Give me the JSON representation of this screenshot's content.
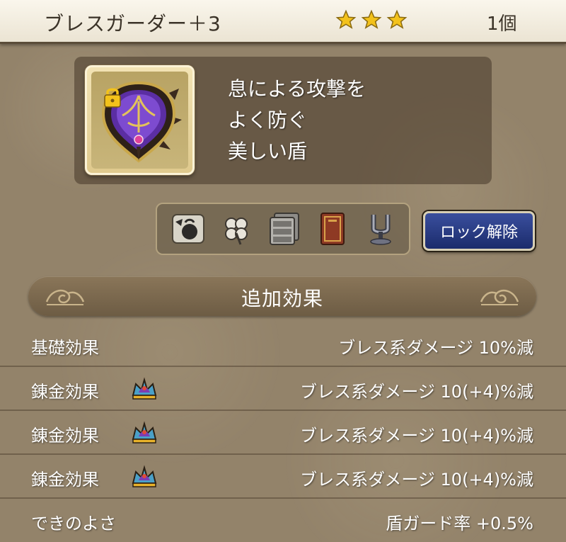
{
  "header": {
    "item_name": "ブレスガーダー＋3",
    "stars": 3,
    "count": "1個"
  },
  "item": {
    "icon": "purple-shield-icon",
    "locked": true,
    "description_lines": [
      "息による攻撃を",
      "よく防ぐ",
      "美しい盾"
    ]
  },
  "tools": [
    {
      "icon": "bag-icon"
    },
    {
      "icon": "clover-icon"
    },
    {
      "icon": "drawer-icon"
    },
    {
      "icon": "book-icon"
    },
    {
      "icon": "tuning-fork-icon"
    }
  ],
  "unlock_button": {
    "label": "ロック解除"
  },
  "section": {
    "title": "追加効果"
  },
  "effects": [
    {
      "label": "基礎効果",
      "alchemy_icon": false,
      "value": "ブレス系ダメージ  10%減"
    },
    {
      "label": "錬金効果",
      "alchemy_icon": true,
      "value": "ブレス系ダメージ  10(+4)%減"
    },
    {
      "label": "錬金効果",
      "alchemy_icon": true,
      "value": "ブレス系ダメージ  10(+4)%減"
    },
    {
      "label": "錬金効果",
      "alchemy_icon": true,
      "value": "ブレス系ダメージ  10(+4)%減"
    },
    {
      "label": "できのよさ",
      "alchemy_icon": false,
      "value": "盾ガード率  +0.5%"
    }
  ],
  "colors": {
    "header_bg": "#f3eee1",
    "panel_bg": "#93836a",
    "button_bg": "#23357b",
    "star": "#f3c21b"
  }
}
